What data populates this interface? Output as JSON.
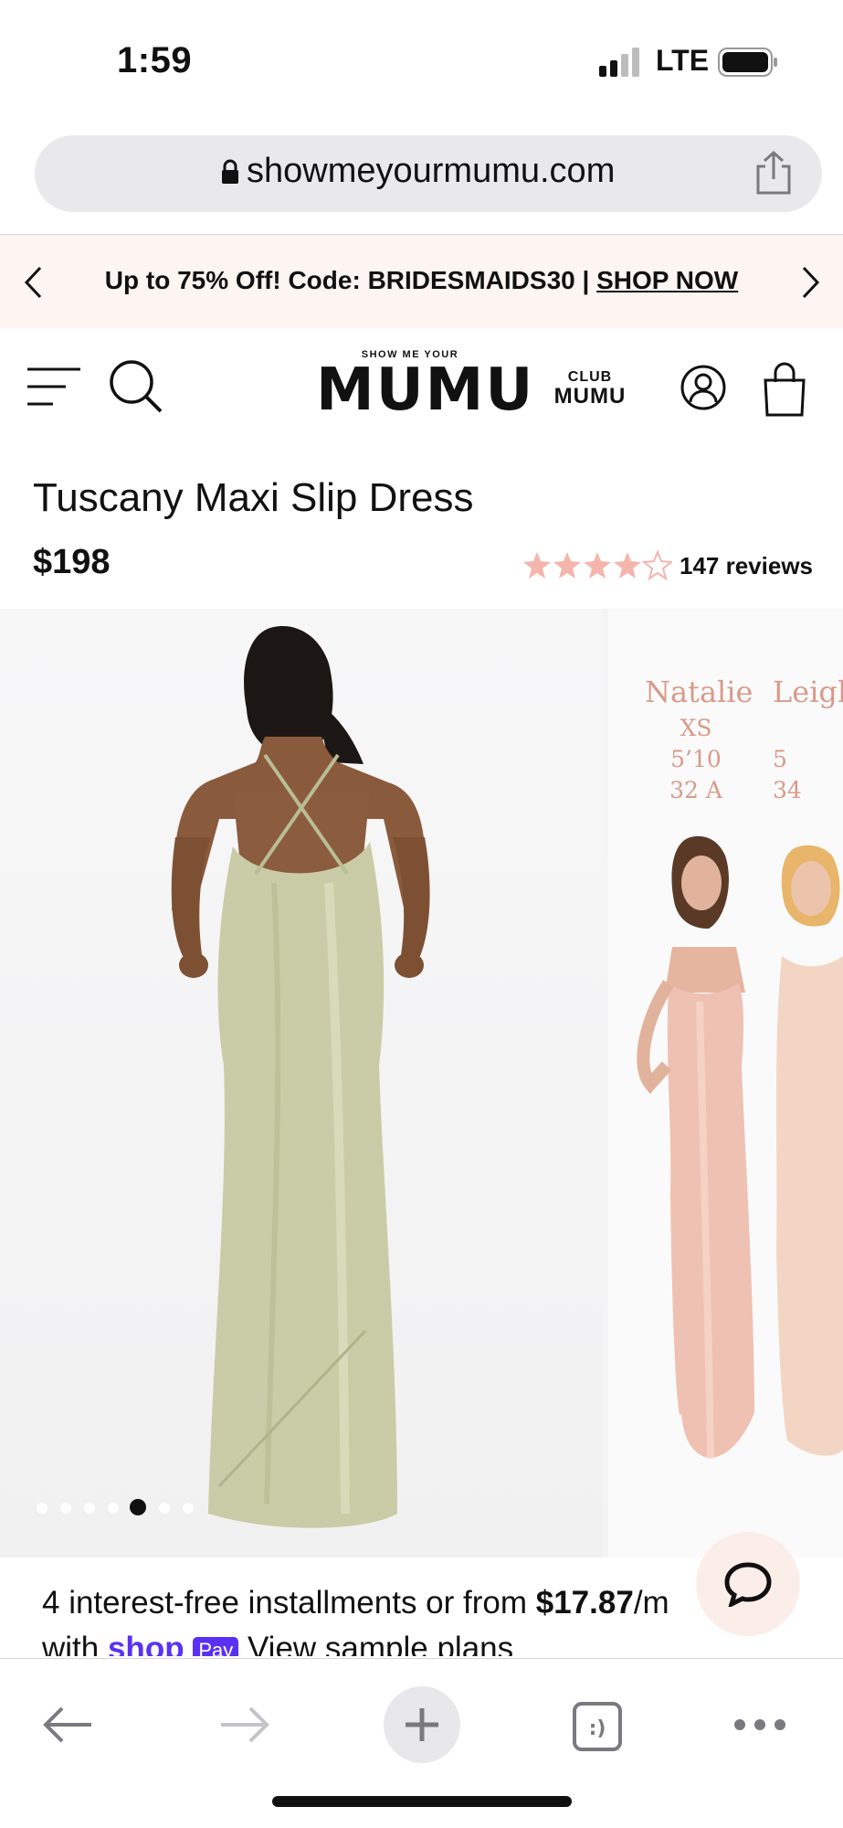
{
  "status_bar": {
    "time": "1:59",
    "network": "LTE",
    "icons": [
      "signal-icon",
      "battery-icon"
    ]
  },
  "browser": {
    "url": "showmeyourmumu.com",
    "icons": [
      "lock-icon",
      "share-icon"
    ]
  },
  "promo_banner": {
    "text": "Up to 75% Off! Code: BRIDESMAIDS30 | ",
    "link": "SHOP NOW"
  },
  "header": {
    "logo_small": "SHOW ME YOUR",
    "logo_big": "MUMU",
    "club_top": "CLUB",
    "club_bottom": "MUMU",
    "icons": [
      "menu-icon",
      "search-icon",
      "account-icon",
      "bag-icon"
    ]
  },
  "product": {
    "title": "Tuscany Maxi Slip Dress",
    "price": "$198",
    "rating": 4,
    "rating_max": 5,
    "reviews": "147 reviews"
  },
  "gallery": {
    "slide_count": 7,
    "active_slide": 5,
    "models": [
      {
        "name": "Natalie",
        "size": "XS",
        "height": "5’10",
        "bust": "32 A"
      },
      {
        "name": "Leigh",
        "size": "",
        "height": "5",
        "bust": "34"
      }
    ],
    "colors": {
      "dress_sage": "#c9cca6",
      "dress_blush": "#efc1b3",
      "model_text": "#d99a8a"
    }
  },
  "installments": {
    "prefix": "4 interest-free installments or from ",
    "amount": "$17.87",
    "suffix": "/m",
    "line2_prefix": "with ",
    "shop_brand": "shop",
    "pay_brand": "Pay",
    "line2_link": " View sample plans"
  },
  "chat": {
    "icon": "chat-icon"
  },
  "toolbar": {
    "icons": [
      "back-arrow-icon",
      "forward-arrow-icon",
      "plus-icon",
      "tabs-icon",
      "more-icon"
    ],
    "tabs_glyph": ":)"
  },
  "colors": {
    "promo_bg": "#fcf5f2",
    "accent_star": "#f4b5ad",
    "shop_pay": "#5a31f4"
  }
}
